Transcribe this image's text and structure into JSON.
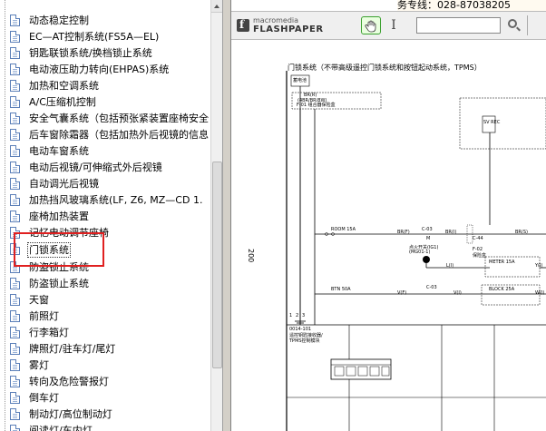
{
  "tree": {
    "items": [
      {
        "label": "动态稳定控制"
      },
      {
        "label": "EC—AT控制系统(FS5A—EL)"
      },
      {
        "label": "钥匙联锁系统/换档锁止系统"
      },
      {
        "label": "电动液压助力转向(EHPAS)系统"
      },
      {
        "label": "加热和空调系统"
      },
      {
        "label": "A/C压缩机控制"
      },
      {
        "label": "安全气囊系统（包括预张紧装置座椅安全"
      },
      {
        "label": "后车窗除霜器（包括加热外后视镜的信息"
      },
      {
        "label": "电动车窗系统"
      },
      {
        "label": "电动后视镜/可伸缩式外后视镜"
      },
      {
        "label": "自动调光后视镜"
      },
      {
        "label": "加热挡风玻璃系统(LF, Z6, MZ—CD 1."
      },
      {
        "label": "座椅加热装置"
      },
      {
        "label": "记忆电动调节座椅"
      },
      {
        "label": "门锁系统"
      },
      {
        "label": "防盗锁止系统"
      },
      {
        "label": "防盗锁止系统"
      },
      {
        "label": "天窗"
      },
      {
        "label": "前照灯"
      },
      {
        "label": "行李箱灯"
      },
      {
        "label": "牌照灯/驻车灯/尾灯"
      },
      {
        "label": "雾灯"
      },
      {
        "label": "转向及危险警报灯"
      },
      {
        "label": "倒车灯"
      },
      {
        "label": "制动灯/高位制动灯"
      },
      {
        "label": "阅读灯/车内灯"
      }
    ],
    "selected_index": 14
  },
  "viewer": {
    "hotline": "务专线：028-87038205",
    "logo_top": "macromedia",
    "logo_bottom": "FLASHPAPER",
    "search_value": ""
  },
  "document": {
    "title": "门锁系统（不带高级遥控门锁系统和按钮起动系统，TPMS）",
    "page_number": "200",
    "labels": {
      "fuse_box": "蓄电池",
      "br_r": "BR(R)",
      "br_r2": "(4BR/BR/8W)",
      "f01": "F-01  组合器保险盒",
      "sv_rec": "SV REC",
      "room": "ROOM 15A",
      "c03a": "C-03",
      "c44": "C-44",
      "br_f": "BR(F)",
      "m_label": "M",
      "br_i": "BR(I)",
      "br_s": "BR(S)",
      "f02": "F-02",
      "f02_name": "保险盒",
      "key_sw": "点火开关(IG1)",
      "key_sub": "(MG01-1)",
      "l_i": "L(I)",
      "meter": "METER 15A",
      "y_i": "Y(I)",
      "btn": "BTN 50A",
      "v_f": "V(F)",
      "c03b": "C-03",
      "v_i": "V(I)",
      "block": "BLOCK 25A",
      "w_i": "W(I)",
      "module_id": "0014-101",
      "module_name1": "遥控钥匙接收器/",
      "module_name2": "TPMS控制模块",
      "num_1": "1",
      "num_2": "2",
      "num_3": "3"
    }
  }
}
